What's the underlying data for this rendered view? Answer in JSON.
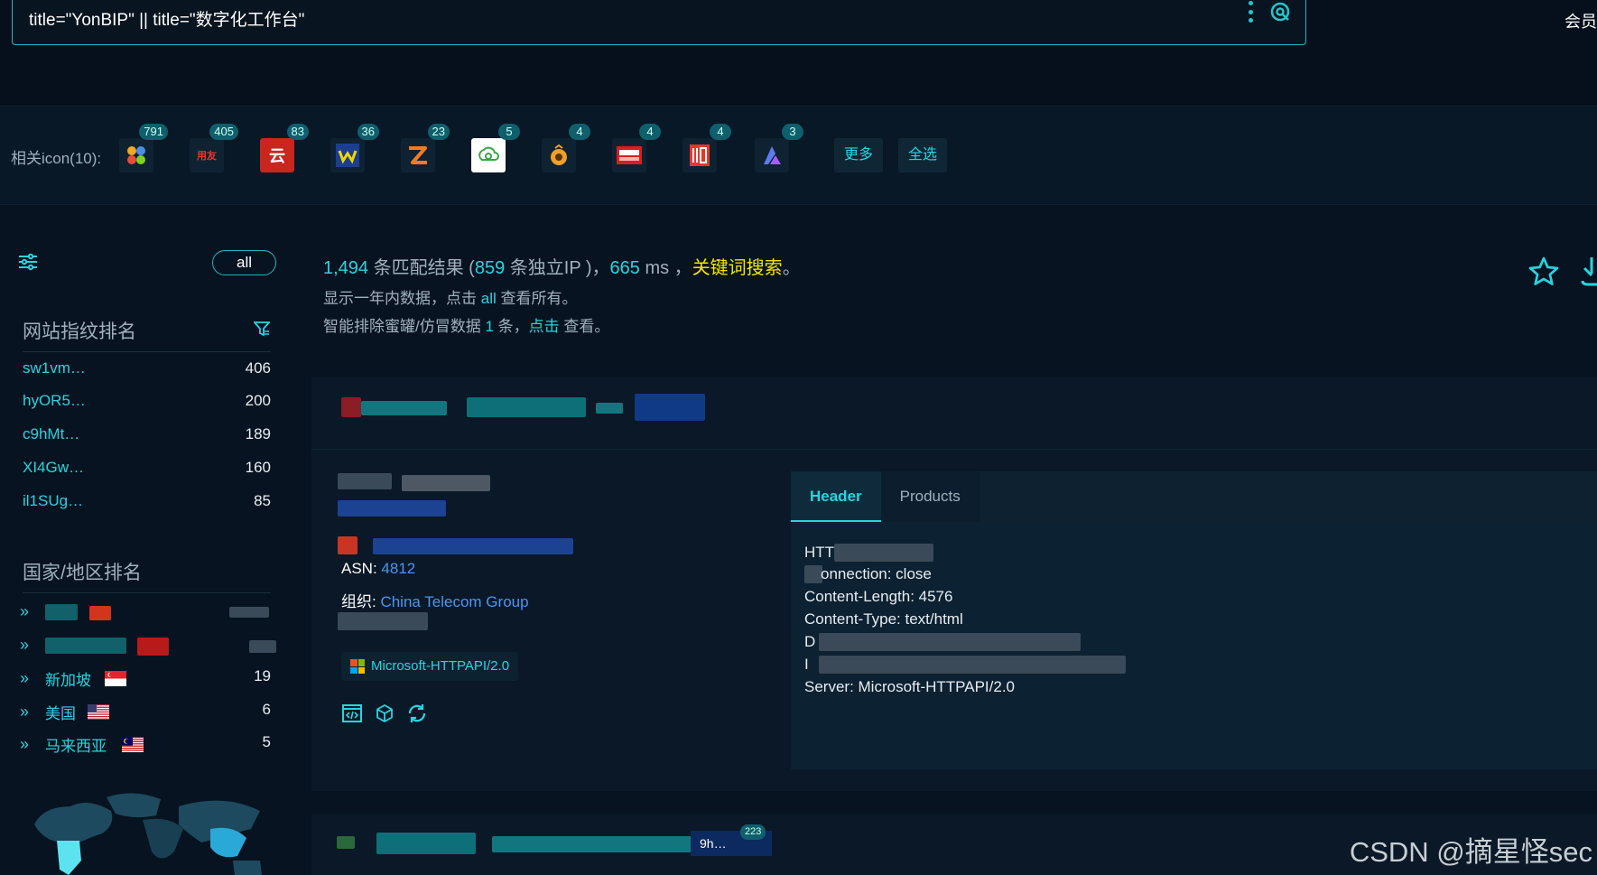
{
  "search": {
    "query": "title=\"YonBIP\" || title=\"数字化工作台\"",
    "vip_label": "会员"
  },
  "icon_bar": {
    "label": "相关icon(10):",
    "icons": [
      {
        "name": "pinwheel-icon",
        "count": "791"
      },
      {
        "name": "yonyou-icon",
        "count": "405",
        "text": "用友"
      },
      {
        "name": "cloud-char-icon",
        "count": "83",
        "text": "云"
      },
      {
        "name": "wm-icon",
        "count": "36"
      },
      {
        "name": "z-arrow-icon",
        "count": "23"
      },
      {
        "name": "recycle-cloud-icon",
        "count": "5"
      },
      {
        "name": "orange-coin-icon",
        "count": "4"
      },
      {
        "name": "red-brand-icon",
        "count": "4"
      },
      {
        "name": "red-seal-icon",
        "count": "4"
      },
      {
        "name": "purple-shape-icon",
        "count": "3"
      }
    ],
    "more_label": "更多",
    "select_all_label": "全选"
  },
  "sidebar": {
    "all_label": "all",
    "fingerprint_title": "网站指纹排名",
    "fingerprints": [
      {
        "name": "sw1vm…",
        "count": "406"
      },
      {
        "name": "hyOR5…",
        "count": "200"
      },
      {
        "name": "c9hMt…",
        "count": "189"
      },
      {
        "name": "XI4Gw…",
        "count": "160"
      },
      {
        "name": "il1SUg…",
        "count": "85"
      }
    ],
    "country_title": "国家/地区排名",
    "countries": [
      {
        "name": "",
        "count": ""
      },
      {
        "name": "",
        "count": ""
      },
      {
        "name": "新加坡",
        "count": "19"
      },
      {
        "name": "美国",
        "count": "6"
      },
      {
        "name": "马来西亚",
        "count": "5"
      }
    ]
  },
  "summary": {
    "total": "1,494",
    "total_suffix": " 条匹配结果 (",
    "ips": "859",
    "ips_suffix": " 条独立IP )，",
    "ms": "665",
    "ms_suffix": " ms ，",
    "keyword": "关键词搜索",
    "period": "。",
    "line2_a": "显示一年内数据，点击 ",
    "line2_all": "all",
    "line2_b": " 查看所有。",
    "line3_a": "智能排除蜜罐/仿冒数据 ",
    "line3_num": "1",
    "line3_b": " 条，",
    "line3_click": "点击",
    "line3_c": " 查看。"
  },
  "result": {
    "asn_label": "ASN: ",
    "asn": "4812",
    "org_label": "组织: ",
    "org": "China Telecom Group",
    "product_tag": "Microsoft-HTTPAPI/2.0",
    "tabs": [
      "Header",
      "Products"
    ],
    "header_lines": {
      "l1": "HTT",
      "l2": "onnection: close",
      "l3": "Content-Length: 4576",
      "l4": "Content-Type: text/html",
      "l5": "D",
      "l6": "I",
      "l7": "Server: Microsoft-HTTPAPI/2.0"
    }
  },
  "result2": {
    "badge": "223",
    "snippet": "9h…"
  },
  "watermark": "CSDN @摘星怪sec",
  "colors": {
    "accent": "#28d4e0",
    "keyword": "#f2e600",
    "link": "#4a96f0",
    "bg": "#071320"
  }
}
